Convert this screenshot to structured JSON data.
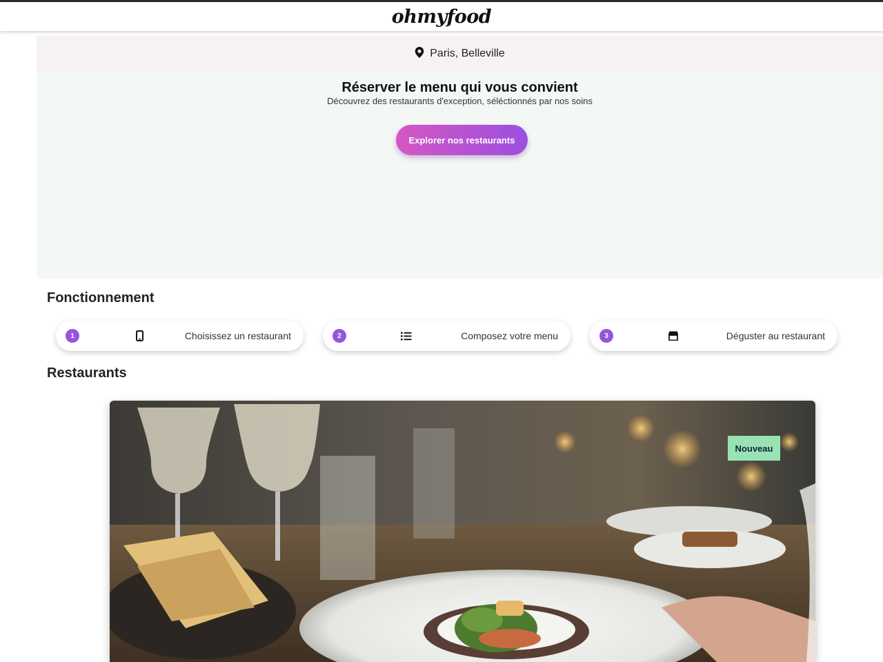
{
  "header": {
    "logo": "ohmyfood"
  },
  "location": {
    "icon": "location-pin-icon",
    "text": "Paris, Belleville"
  },
  "hero": {
    "title": "Réserver le menu qui vous convient",
    "subtitle": "Découvrez des restaurants d'exception, séléctionnés par nos soins",
    "cta_label": "Explorer nos restaurants",
    "cta_gradient": [
      "#d457c2",
      "#9b4fe0"
    ]
  },
  "how_it_works": {
    "title": "Fonctionnement",
    "steps": [
      {
        "number": "1",
        "icon": "smartphone-icon",
        "label": "Choisissez un restaurant"
      },
      {
        "number": "2",
        "icon": "list-icon",
        "label": "Composez votre menu"
      },
      {
        "number": "3",
        "icon": "store-icon",
        "label": "Déguster au restaurant"
      }
    ]
  },
  "restaurants": {
    "title": "Restaurants",
    "cards": [
      {
        "image": "restaurant-table-photo",
        "badge": "Nouveau",
        "badge_color": "#99e2b4"
      }
    ]
  },
  "colors": {
    "accent": "#9356dc",
    "hero_bg": "#f4f8f5",
    "location_bg": "#f6f2f3"
  }
}
